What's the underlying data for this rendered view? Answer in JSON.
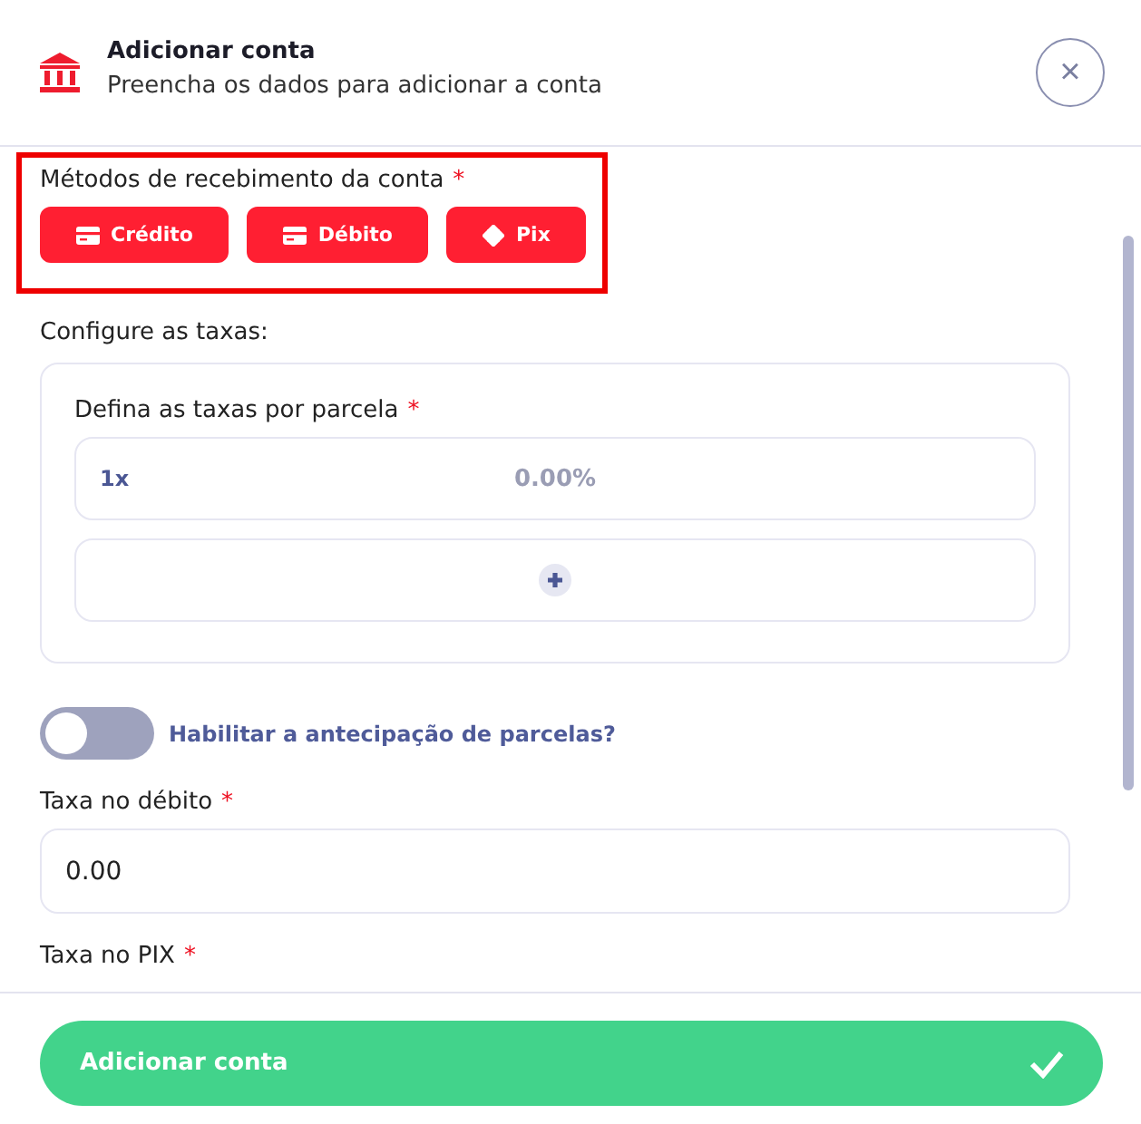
{
  "header": {
    "title": "Adicionar conta",
    "subtitle": "Preencha os dados para adicionar a conta",
    "close": "×"
  },
  "methods": {
    "label": "Métodos de recebimento da conta",
    "required": "*",
    "items": [
      {
        "label": "Crédito",
        "kind": "card",
        "selected": true
      },
      {
        "label": "Débito",
        "kind": "card",
        "selected": true
      },
      {
        "label": "Pix",
        "kind": "pix",
        "selected": true
      }
    ]
  },
  "fees": {
    "label": "Configure as taxas:",
    "installments_label": "Defina as taxas por parcela",
    "required": "*",
    "rows": [
      {
        "installment": "1x",
        "placeholder": "0.00%"
      }
    ]
  },
  "anticipation": {
    "label": "Habilitar a antecipação de parcelas?",
    "on": false
  },
  "fields": [
    {
      "label": "Taxa no débito",
      "required": "*",
      "value": "0.00"
    },
    {
      "label": "Taxa no PIX",
      "required": "*"
    }
  ],
  "submit": {
    "label": "Adicionar conta"
  }
}
